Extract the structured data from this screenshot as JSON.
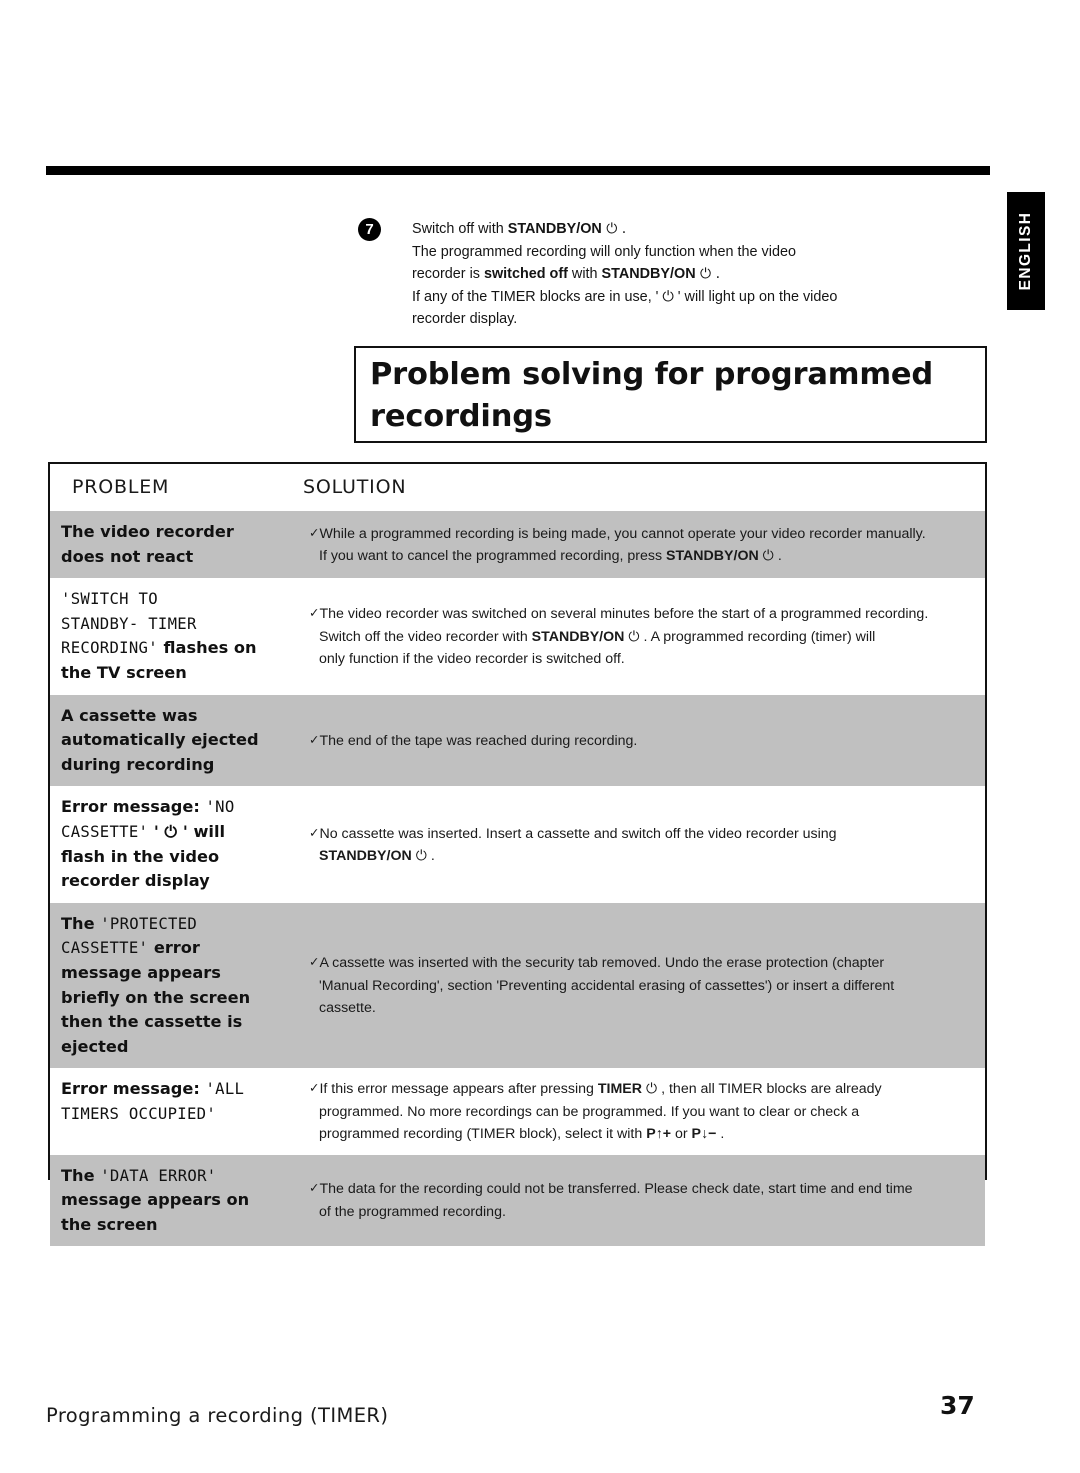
{
  "page": {
    "language_tab": "ENGLISH",
    "footer_chapter": "Programming a recording (TIMER)",
    "page_number": "37"
  },
  "step": {
    "number": "7",
    "line1_a": "Switch off with ",
    "line1_b": "STANDBY/ON",
    "line1_c": " ⏻ .",
    "line2": "The programmed recording will only function when the video",
    "line3_a": "recorder is ",
    "line3_b": "switched off",
    "line3_c": " with ",
    "line3_d": "STANDBY/ON",
    "line3_e": " ⏻ .",
    "line4": "If any of the TIMER blocks are in use, ' ⏻ ' will light up on the video",
    "line5": "recorder display."
  },
  "title": {
    "line1": "Problem solving for programmed",
    "line2": "recordings"
  },
  "table": {
    "headers": {
      "problem": "PROBLEM",
      "solution": "SOLUTION"
    },
    "rows": [
      {
        "shaded": true,
        "problem_plain": "The video recorder does not react",
        "problem_parts": [
          {
            "text": "The video recorder",
            "style": "bold"
          },
          {
            "text": "does not react",
            "style": "bold"
          }
        ],
        "solution_lines": [
          {
            "check": true,
            "text": "While a programmed recording is being made, you cannot operate your video recorder manually.",
            "justify": true
          },
          {
            "check": false,
            "indent": true,
            "pre": "If you want to cancel the programmed recording, press ",
            "strong": "STANDBY/ON",
            "post": " ⏻ .",
            "justify": false
          }
        ]
      },
      {
        "shaded": false,
        "problem_plain": "'SWITCH TO STANDBY- TIMER RECORDING' flashes on the TV screen",
        "problem_parts": [
          {
            "text": "'SWITCH TO",
            "style": "mono"
          },
          {
            "text": "STANDBY- TIMER",
            "style": "mono"
          },
          {
            "text": "RECORDING'",
            "style": "mono",
            "suffix": " flashes on",
            "suffix_style": "bold"
          },
          {
            "text": "the TV screen",
            "style": "bold"
          }
        ],
        "solution_lines": [
          {
            "check": true,
            "text": "The video recorder was switched on several minutes before the start of a programmed recording.",
            "justify": true
          },
          {
            "check": false,
            "indent": true,
            "pre": "Switch off the video recorder with ",
            "strong": "STANDBY/ON",
            "post": " ⏻ . A programmed recording (timer) will",
            "justify": true
          },
          {
            "check": false,
            "indent": true,
            "text": "only function if the video recorder is switched off.",
            "justify": false
          }
        ]
      },
      {
        "shaded": true,
        "problem_plain": "A cassette was automatically ejected during recording",
        "problem_parts": [
          {
            "text": "A cassette was",
            "style": "bold"
          },
          {
            "text": "automatically ejected",
            "style": "bold"
          },
          {
            "text": "during recording",
            "style": "bold"
          }
        ],
        "solution_lines": [
          {
            "check": true,
            "text": "The end of the tape was reached during recording.",
            "justify": false
          }
        ]
      },
      {
        "shaded": false,
        "problem_plain": "Error message: 'NO CASSETTE' ' ⏻ ' will flash in the video recorder display",
        "problem_parts": [
          {
            "text": "Error message: ",
            "style": "bold",
            "suffix": "'NO",
            "suffix_style": "mono"
          },
          {
            "text": "CASSETTE'",
            "style": "mono",
            "suffix": " ' ⏻ ' will",
            "suffix_style": "bold"
          },
          {
            "text": "flash in the video",
            "style": "bold"
          },
          {
            "text": "recorder display",
            "style": "bold"
          }
        ],
        "solution_lines": [
          {
            "check": true,
            "text": "No cassette was inserted. Insert a cassette and switch off the video recorder using",
            "justify": true
          },
          {
            "check": false,
            "indent": true,
            "strong": "STANDBY/ON",
            "post": " ⏻ .",
            "justify": false
          }
        ]
      },
      {
        "shaded": true,
        "problem_plain": "The 'PROTECTED CASSETTE' error message appears briefly on the screen then the cassette is ejected",
        "problem_parts": [
          {
            "text": "The ",
            "style": "bold",
            "suffix": "'PROTECTED",
            "suffix_style": "mono"
          },
          {
            "text": "CASSETTE'",
            "style": "mono",
            "suffix": " error",
            "suffix_style": "bold"
          },
          {
            "text": "message appears",
            "style": "bold"
          },
          {
            "text": "briefly on the screen",
            "style": "bold"
          },
          {
            "text": "then the cassette is",
            "style": "bold"
          },
          {
            "text": "ejected",
            "style": "bold"
          }
        ],
        "solution_lines": [
          {
            "check": true,
            "text": "A cassette was inserted with the security tab removed. Undo the erase protection (chapter",
            "justify": true
          },
          {
            "check": false,
            "indent": true,
            "text": "'Manual Recording', section 'Preventing accidental erasing of cassettes') or insert a different",
            "justify": true
          },
          {
            "check": false,
            "indent": true,
            "text": "cassette.",
            "justify": false
          }
        ]
      },
      {
        "shaded": false,
        "problem_plain": "Error message: 'ALL TIMERS OCCUPIED'",
        "problem_parts": [
          {
            "text": "Error message: ",
            "style": "bold",
            "suffix": "'ALL",
            "suffix_style": "mono"
          },
          {
            "text": "TIMERS OCCUPIED'",
            "style": "mono"
          }
        ],
        "solution_lines": [
          {
            "check": true,
            "pre": "If this error message appears after pressing ",
            "strong": "TIMER",
            "post": " ⏻ , then all TIMER blocks are already",
            "justify": true
          },
          {
            "check": false,
            "indent": true,
            "text": "programmed. No more recordings can be programmed. If you want to clear or check a",
            "justify": true
          },
          {
            "check": false,
            "indent": true,
            "pre": "programmed recording (TIMER block), select it with ",
            "strong": "P↑+",
            "mid": " or ",
            "strong2": "P↓−",
            "post": " .",
            "justify": false
          }
        ]
      },
      {
        "shaded": true,
        "problem_plain": "The 'DATA ERROR' message appears on the screen",
        "problem_parts": [
          {
            "text": "The ",
            "style": "bold",
            "suffix": "'DATA ERROR'",
            "suffix_style": "mono"
          },
          {
            "text": "message appears on",
            "style": "bold"
          },
          {
            "text": "the screen",
            "style": "bold"
          }
        ],
        "solution_lines": [
          {
            "check": true,
            "text": "The data for the recording could not be transferred. Please check date, start time and end time",
            "justify": true
          },
          {
            "check": false,
            "indent": true,
            "text": "of the programmed recording.",
            "justify": false
          }
        ]
      }
    ]
  }
}
